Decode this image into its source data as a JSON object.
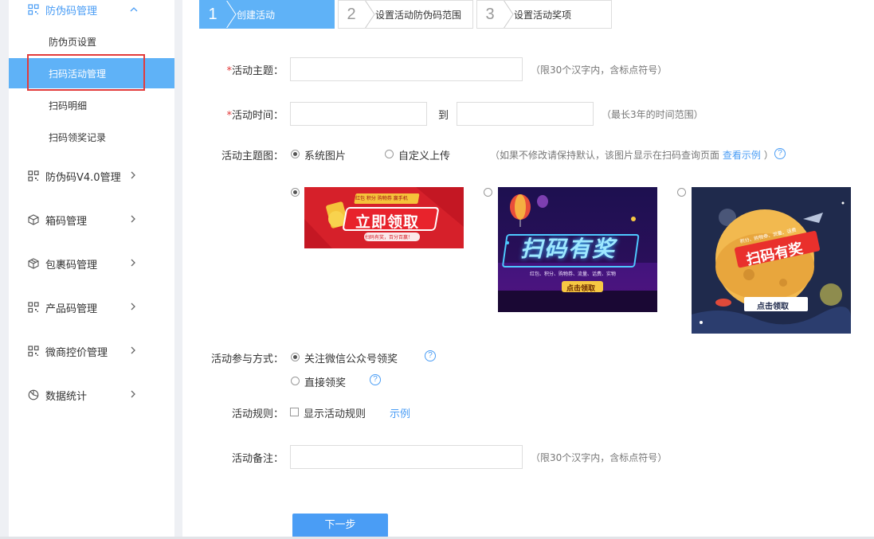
{
  "sidebar": {
    "group_anti_fake": "防伪码管理",
    "sub_items": [
      "防伪页设置",
      "扫码活动管理",
      "扫码明细",
      "扫码领奖记录"
    ],
    "groups": [
      {
        "label": "防伪码V4.0管理",
        "icon": "qr-grid-icon"
      },
      {
        "label": "箱码管理",
        "icon": "box-icon"
      },
      {
        "label": "包裹码管理",
        "icon": "package-icon"
      },
      {
        "label": "产品码管理",
        "icon": "qr-grid-icon"
      },
      {
        "label": "微商控价管理",
        "icon": "qr-grid-icon"
      },
      {
        "label": "数据统计",
        "icon": "pie-chart-icon"
      }
    ]
  },
  "steps": [
    {
      "num": "1",
      "label": "创建活动"
    },
    {
      "num": "2",
      "label": "设置活动防伪码范围"
    },
    {
      "num": "3",
      "label": "设置活动奖项"
    }
  ],
  "form": {
    "theme_label": "活动主题：",
    "theme_hint": "（限30个汉字内，含标点符号）",
    "time_label": "活动时间：",
    "time_to": "到",
    "time_hint": "（最长3年的时间范围）",
    "image_label": "活动主题图：",
    "image_option_system": "系统图片",
    "image_option_custom": "自定义上传",
    "image_hint": "（如果不修改请保持默认，该图片显示在扫码查询页面",
    "image_hint_link": "查看示例",
    "image_hint_end": "）",
    "banners": [
      {
        "title": "立即领取",
        "small": "红包 积分 购物券 赢手机",
        "sub": "扫码有奖，百分百赢！"
      },
      {
        "title": "扫码有奖",
        "small": "红包、积分、购物券、流量、话费、实物",
        "btn": "点击领取"
      },
      {
        "title": "扫码有奖",
        "small": "积分、购物券、流量、话费",
        "btn": "点击领取"
      }
    ],
    "participate_label": "活动参与方式：",
    "participate_option1": "关注微信公众号领奖",
    "participate_option2": "直接领奖",
    "rules_label": "活动规则：",
    "rules_checkbox": "显示活动规则",
    "rules_example": "示例",
    "remark_label": "活动备注：",
    "remark_hint": "（限30个汉字内，含标点符号）",
    "next_button": "下一步",
    "required_mark": "*",
    "help_glyph": "?"
  },
  "colors": {
    "accent": "#4a9df5",
    "selected_bg": "#5fb2f7",
    "required": "#e23b3b",
    "highlight": "#e23b3b"
  }
}
